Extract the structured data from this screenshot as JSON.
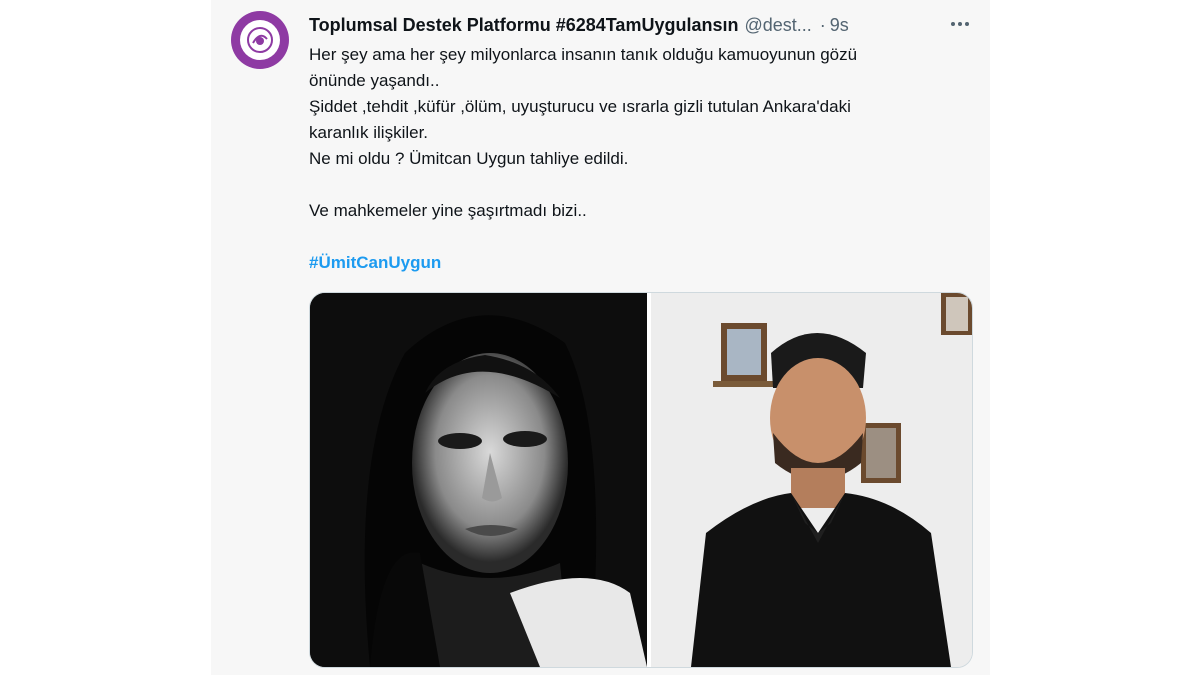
{
  "tweet": {
    "author_name": "Toplumsal Destek Platformu #6284TamUygulansın",
    "handle": "@dest...",
    "dot": "·",
    "time": "9s",
    "lines": [
      "Her şey ama her şey milyonlarca insanın tanık olduğu kamuoyunun gözü",
      "önünde yaşandı..",
      "Şiddet ,tehdit ,küfür ,ölüm, uyuşturucu ve ısrarla gizli tutulan Ankara'daki",
      "karanlık ilişkiler.",
      "Ne mi oldu ? Ümitcan Uygun tahliye edildi."
    ],
    "closing_line": "Ve mahkemeler yine şaşırtmadı bizi..",
    "hashtag": "#ÜmitCanUygun"
  },
  "icons": {
    "avatar": "organization-logo",
    "more": "more-options-icon"
  },
  "colors": {
    "avatar_ring": "#8e3aa3",
    "hashtag": "#1d9bf0",
    "muted_text": "#536471",
    "card_background": "#f7f7f7"
  }
}
